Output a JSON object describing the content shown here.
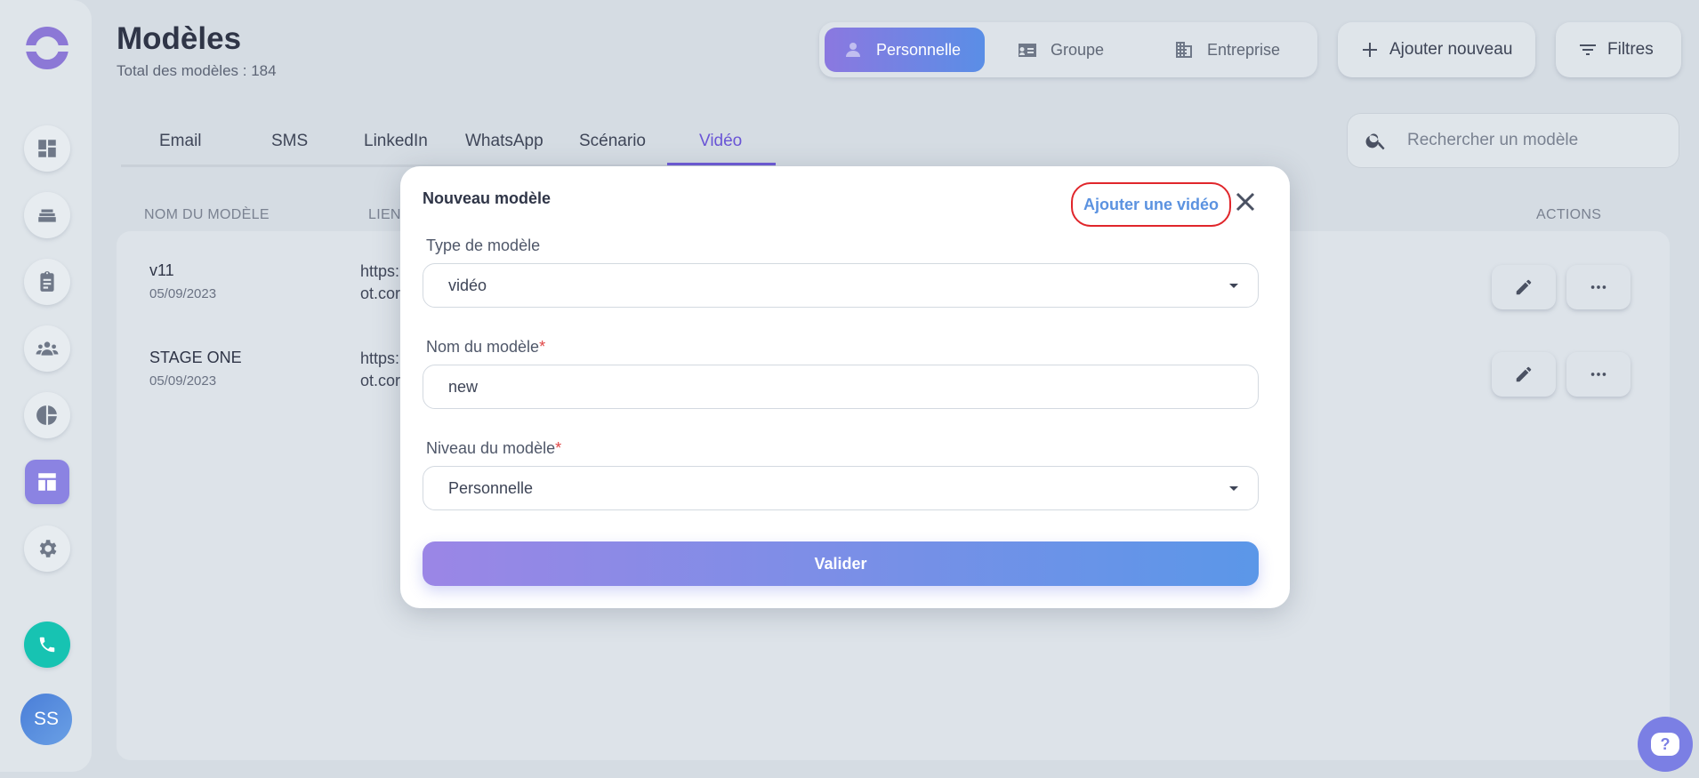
{
  "header": {
    "title": "Modèles",
    "subtitle": "Total des modèles : 184"
  },
  "levels": [
    {
      "label": "Personnelle",
      "active": true,
      "icon": "person-icon"
    },
    {
      "label": "Groupe",
      "active": false,
      "icon": "id-card-icon"
    },
    {
      "label": "Entreprise",
      "active": false,
      "icon": "building-icon"
    }
  ],
  "toolbar": {
    "add_label": "Ajouter nouveau",
    "filters_label": "Filtres"
  },
  "tabs": [
    "Email",
    "SMS",
    "LinkedIn",
    "WhatsApp",
    "Scénario",
    "Vidéo"
  ],
  "active_tab": "Vidéo",
  "search": {
    "placeholder": "Rechercher un modèle"
  },
  "table": {
    "headers": {
      "name": "NOM DU MODÈLE",
      "link": "LIEN",
      "actions": "ACTIONS"
    },
    "rows": [
      {
        "name": "v11",
        "date": "05/09/2023",
        "link_line1": "https:",
        "link_line2": "ot.cor"
      },
      {
        "name": "STAGE ONE",
        "date": "05/09/2023",
        "link_line1": "https:",
        "link_line2": "ot.cor"
      }
    ]
  },
  "modal": {
    "title": "Nouveau modèle",
    "add_video_label": "Ajouter une vidéo",
    "type_label": "Type de modèle",
    "type_value": "vidéo",
    "name_label": "Nom du modèle",
    "name_value": "new",
    "level_label": "Niveau du modèle",
    "level_value": "Personnelle",
    "required_mark": "*",
    "submit_label": "Valider"
  },
  "sidebar": {
    "avatar_initials": "SS",
    "items": [
      "dashboard-icon",
      "stack-icon",
      "clipboard-icon",
      "team-icon",
      "pie-chart-icon",
      "templates-icon",
      "gear-icon"
    ]
  },
  "help": {
    "glyph": "?"
  },
  "colors": {
    "accent_purple": "#8b78e0",
    "accent_blue": "#5a8ee6",
    "highlight_red": "#e0262b",
    "phone_teal": "#17c3b2"
  }
}
